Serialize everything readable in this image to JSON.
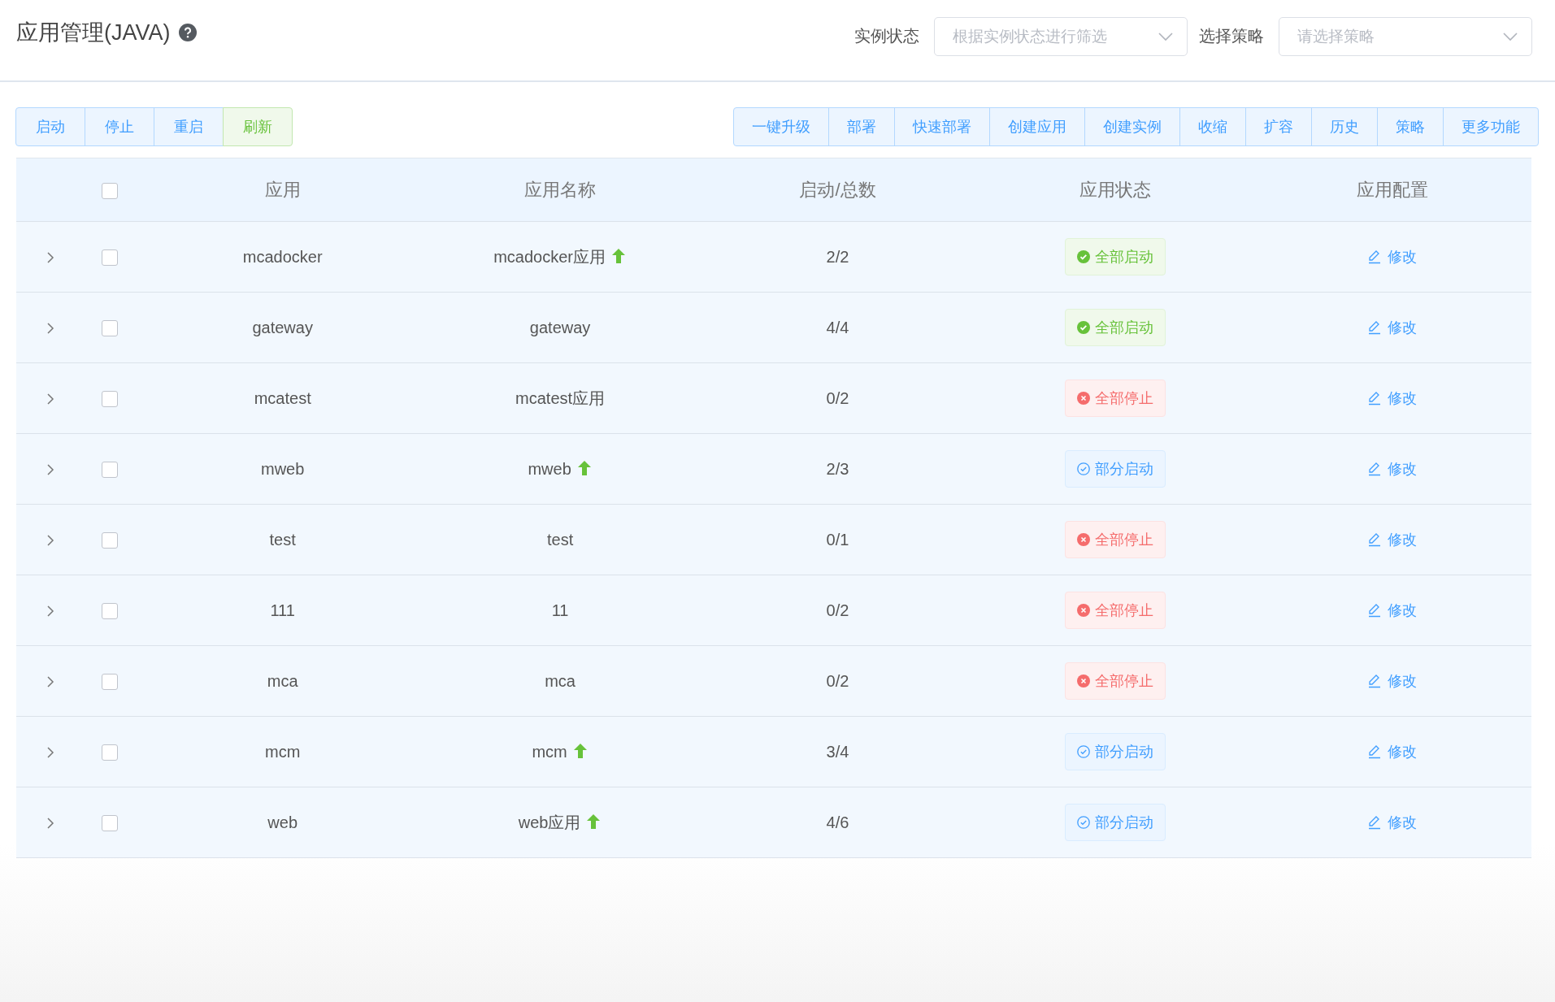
{
  "header": {
    "title": "应用管理(JAVA)",
    "filters": [
      {
        "label": "实例状态",
        "placeholder": "根据实例状态进行筛选"
      },
      {
        "label": "选择策略",
        "placeholder": "请选择策略"
      }
    ]
  },
  "left_actions": [
    {
      "label": "启动",
      "kind": "primary"
    },
    {
      "label": "停止",
      "kind": "primary"
    },
    {
      "label": "重启",
      "kind": "primary"
    },
    {
      "label": "刷新",
      "kind": "success"
    }
  ],
  "right_actions": [
    "一键升级",
    "部署",
    "快速部署",
    "创建应用",
    "创建实例",
    "收缩",
    "扩容",
    "历史",
    "策略",
    "更多功能"
  ],
  "table": {
    "all_checked": false,
    "columns": [
      "应用",
      "应用名称",
      "启动/总数",
      "应用状态",
      "应用配置"
    ],
    "rows": [
      {
        "expanded": false,
        "checked": false,
        "app": "mcadocker",
        "name": "mcadocker应用",
        "upgrade": true,
        "count": "2/2",
        "status": {
          "kind": "running",
          "label": "全部启动"
        },
        "action": "修改"
      },
      {
        "expanded": false,
        "checked": false,
        "app": "gateway",
        "name": "gateway",
        "upgrade": false,
        "count": "4/4",
        "status": {
          "kind": "running",
          "label": "全部启动"
        },
        "action": "修改"
      },
      {
        "expanded": false,
        "checked": false,
        "app": "mcatest",
        "name": "mcatest应用",
        "upgrade": false,
        "count": "0/2",
        "status": {
          "kind": "stopped",
          "label": "全部停止"
        },
        "action": "修改"
      },
      {
        "expanded": false,
        "checked": false,
        "app": "mweb",
        "name": "mweb",
        "upgrade": true,
        "count": "2/3",
        "status": {
          "kind": "partial",
          "label": "部分启动"
        },
        "action": "修改"
      },
      {
        "expanded": false,
        "checked": false,
        "app": "test",
        "name": "test",
        "upgrade": false,
        "count": "0/1",
        "status": {
          "kind": "stopped",
          "label": "全部停止"
        },
        "action": "修改"
      },
      {
        "expanded": false,
        "checked": false,
        "app": "111",
        "name": "11",
        "upgrade": false,
        "count": "0/2",
        "status": {
          "kind": "stopped",
          "label": "全部停止"
        },
        "action": "修改"
      },
      {
        "expanded": false,
        "checked": false,
        "app": "mca",
        "name": "mca",
        "upgrade": false,
        "count": "0/2",
        "status": {
          "kind": "stopped",
          "label": "全部停止"
        },
        "action": "修改"
      },
      {
        "expanded": false,
        "checked": false,
        "app": "mcm",
        "name": "mcm",
        "upgrade": true,
        "count": "3/4",
        "status": {
          "kind": "partial",
          "label": "部分启动"
        },
        "action": "修改"
      },
      {
        "expanded": false,
        "checked": false,
        "app": "web",
        "name": "web应用",
        "upgrade": true,
        "count": "4/6",
        "status": {
          "kind": "partial",
          "label": "部分启动"
        },
        "action": "修改"
      }
    ]
  }
}
